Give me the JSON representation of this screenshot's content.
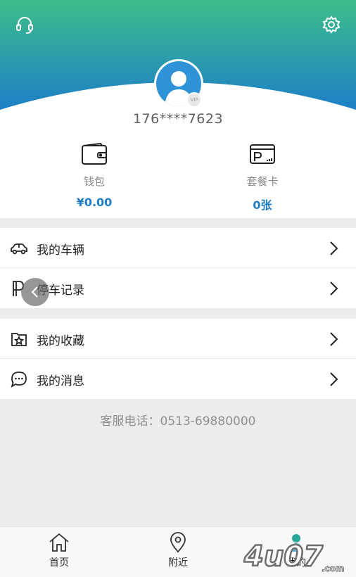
{
  "header": {
    "headset_icon": "headset-icon",
    "settings_icon": "gear-icon"
  },
  "user": {
    "phone": "176****7623",
    "vip_badge": "VIP"
  },
  "stats": {
    "wallet": {
      "label": "钱包",
      "value": "¥0.00",
      "icon": "wallet-icon"
    },
    "card": {
      "label": "套餐卡",
      "value": "0张",
      "icon": "parking-card-icon"
    }
  },
  "menu": [
    {
      "label": "我的车辆",
      "icon": "car-icon"
    },
    {
      "label": "停车记录",
      "icon": "parking-record-icon"
    },
    {
      "label": "我的收藏",
      "icon": "favorite-folder-icon"
    },
    {
      "label": "我的消息",
      "icon": "message-icon"
    }
  ],
  "service": {
    "text": "客服电话：0513-69880000"
  },
  "tabs": [
    {
      "label": "首页",
      "icon": "home-icon"
    },
    {
      "label": "附近",
      "icon": "location-pin-icon"
    },
    {
      "label": "我的",
      "icon": "profile-icon",
      "active": true
    }
  ],
  "watermark": {
    "text": "4u07.com"
  },
  "colors": {
    "gradient_top": "#3cbd8a",
    "gradient_bottom": "#1d7fc7",
    "accent_blue": "#1f7ec4",
    "background": "#ececec"
  }
}
